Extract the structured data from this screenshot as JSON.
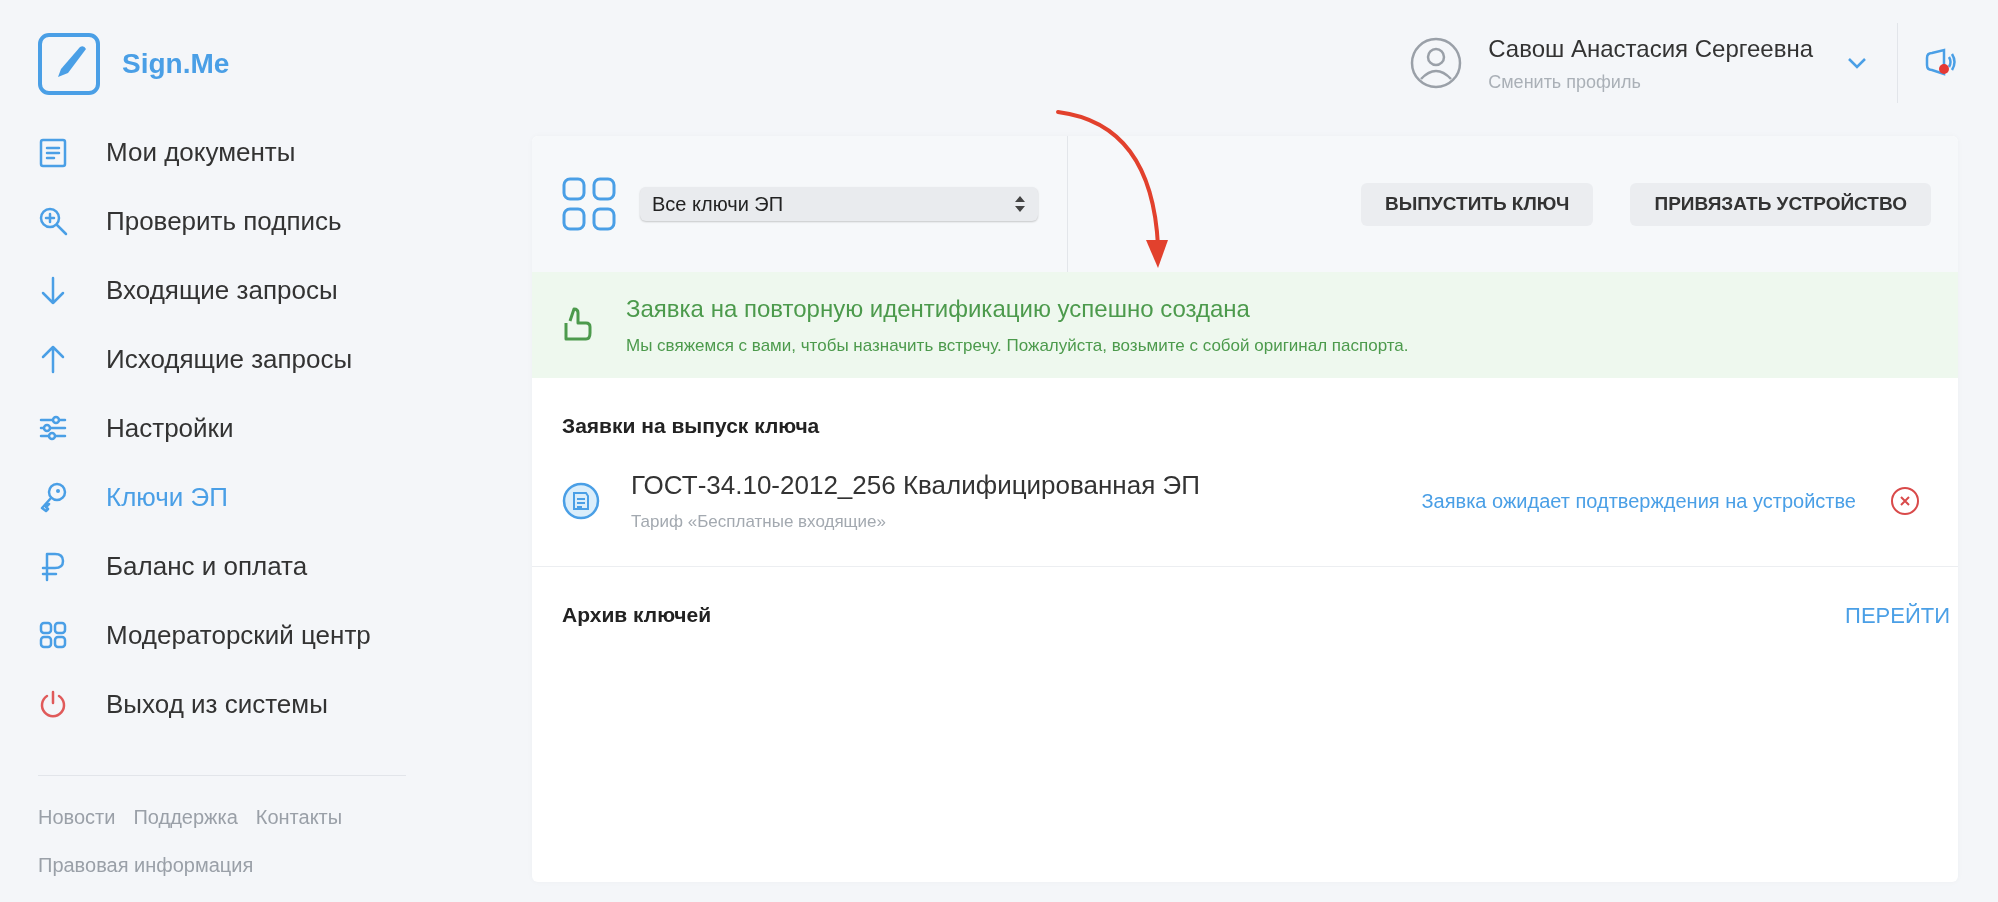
{
  "logo": {
    "text": "Sign.Me"
  },
  "sidebar": {
    "items": [
      {
        "label": "Мои документы",
        "selected": false
      },
      {
        "label": "Проверить подпись",
        "selected": false
      },
      {
        "label": "Входящие запросы",
        "selected": false
      },
      {
        "label": "Исходящие запросы",
        "selected": false
      },
      {
        "label": "Настройки",
        "selected": false
      },
      {
        "label": "Ключи ЭП",
        "selected": true
      },
      {
        "label": "Баланс и оплата",
        "selected": false
      },
      {
        "label": "Модераторский центр",
        "selected": false
      },
      {
        "label": "Выход из системы",
        "selected": false
      }
    ],
    "footer_links": [
      "Новости",
      "Поддержка",
      "Контакты",
      "Правовая информация"
    ]
  },
  "profile": {
    "name": "Савош Анастасия Сергеевна",
    "subtitle": "Сменить профиль",
    "has_notification": true
  },
  "toolbar": {
    "filter": {
      "value": "Все ключи ЭП"
    },
    "buttons": [
      "ВЫПУСТИТЬ КЛЮЧ",
      "ПРИВЯЗАТЬ УСТРОЙСТВО"
    ]
  },
  "notice": {
    "title": "Заявка на повторную идентификацию успешно создана",
    "text": "Мы свяжемся с вами, чтобы назначить встречу. Пожалуйста, возьмите с собой оригинал паспорта."
  },
  "requests": {
    "title": "Заявки на выпуск ключа",
    "items": [
      {
        "title": "ГОСТ-34.10-2012_256 Квалифицированная ЭП",
        "subtitle": "Тариф «Бесплатные входящие»",
        "status": "Заявка ожидает подтверждения на устройстве"
      }
    ]
  },
  "archive": {
    "title": "Архив ключей",
    "link": "ПЕРЕЙТИ"
  }
}
